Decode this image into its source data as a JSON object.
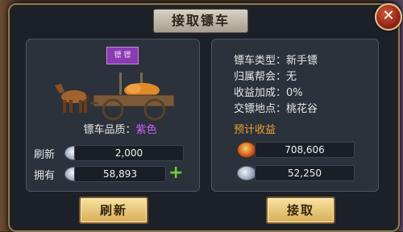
{
  "dialog": {
    "title": "接取镖车"
  },
  "left_panel": {
    "flag_text": "镖 镖",
    "quality_label": "镖车品质：",
    "quality_value": "紫色",
    "refresh_label": "刷新",
    "refresh_cost": "2,000",
    "own_label": "拥有",
    "own_amount": "58,893"
  },
  "right_panel": {
    "info": [
      "镖车类型：新手镖",
      "归属帮会：无",
      "收益加成：0%",
      "交镖地点：桃花谷"
    ],
    "expected_label": "预计收益",
    "reward_gold": "708,606",
    "reward_silver": "52,250"
  },
  "buttons": {
    "refresh": "刷新",
    "accept": "接取"
  },
  "colors": {
    "quality_purple": "#d060ff",
    "expected_orange": "#f0a030"
  }
}
